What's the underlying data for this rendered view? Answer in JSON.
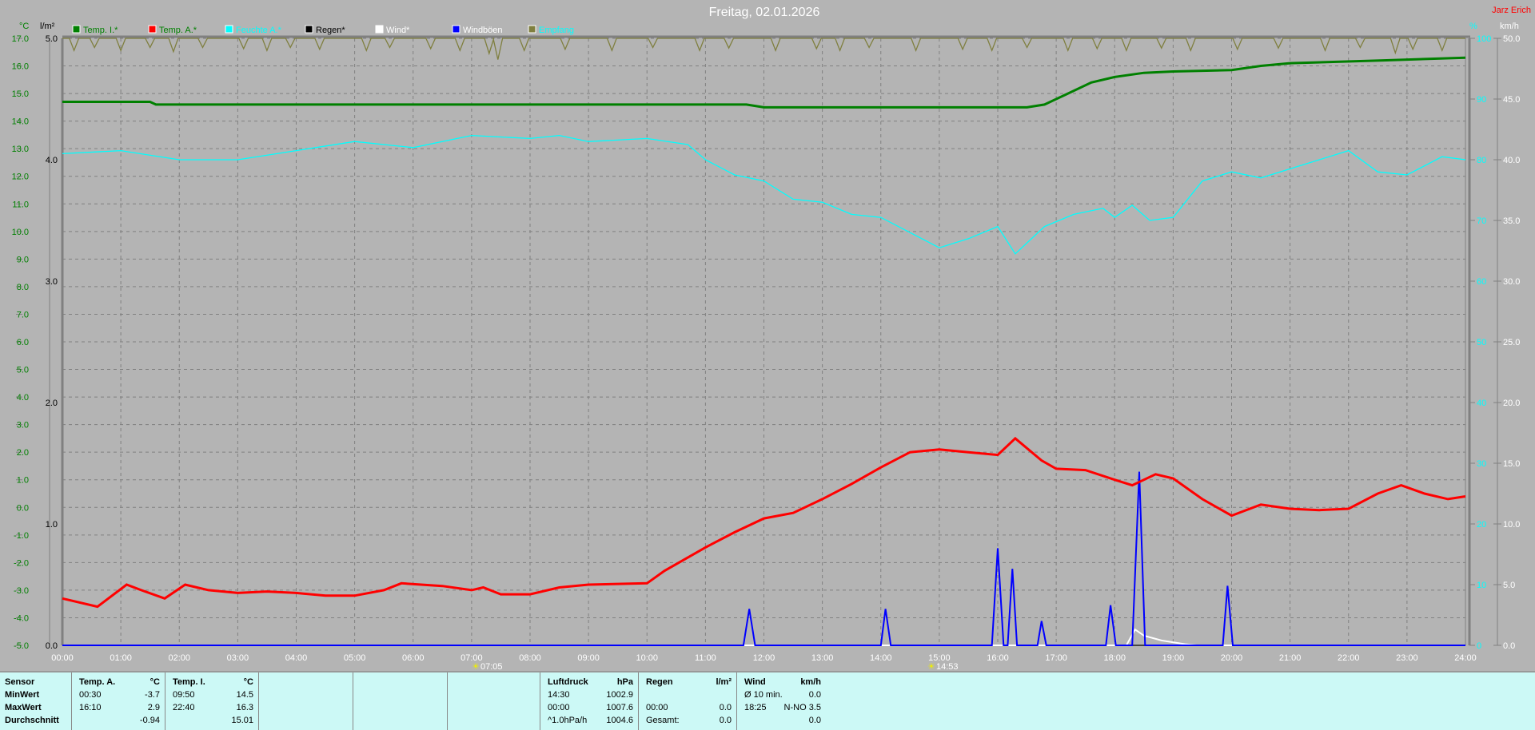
{
  "title": "Freitag, 02.01.2026",
  "author": "Jarz Erich",
  "legend": [
    {
      "label": "Temp. I.*",
      "color": "#008000"
    },
    {
      "label": "Temp. A.*",
      "color": "#ff0000",
      "text_color": "#008000"
    },
    {
      "label": "Feuchte A.*",
      "color": "#00ffff"
    },
    {
      "label": "Regen*",
      "color": "#000000"
    },
    {
      "label": "Wind*",
      "color": "#ffffff"
    },
    {
      "label": "Windböen",
      "color": "#0000ff",
      "text_color": "#ffffff"
    },
    {
      "label": "Empfang",
      "color": "#7f7f3f",
      "text_color": "#00ffff"
    }
  ],
  "axes": {
    "temp_unit": "°C",
    "rain_unit": "l/m²",
    "hum_unit": "%",
    "wind_unit": "km/h"
  },
  "sun": {
    "sunrise": "07:05",
    "sunset": "14:53"
  },
  "chart_data": {
    "type": "line",
    "title": "Freitag, 02.01.2026",
    "x_range": [
      0,
      24
    ],
    "x_ticks": [
      "00:00",
      "01:00",
      "02:00",
      "03:00",
      "04:00",
      "05:00",
      "06:00",
      "07:00",
      "08:00",
      "09:00",
      "10:00",
      "11:00",
      "12:00",
      "13:00",
      "14:00",
      "15:00",
      "16:00",
      "17:00",
      "18:00",
      "19:00",
      "20:00",
      "21:00",
      "22:00",
      "23:00",
      "24:00"
    ],
    "y_temp": {
      "range": [
        -5,
        17
      ],
      "ticks": [
        "17.0",
        "16.0",
        "15.0",
        "14.0",
        "13.0",
        "12.0",
        "11.0",
        "10.0",
        "9.0",
        "8.0",
        "7.0",
        "6.0",
        "5.0",
        "4.0",
        "3.0",
        "2.0",
        "1.0",
        "0.0",
        "-1.0",
        "-2.0",
        "-3.0",
        "-4.0",
        "-5.0"
      ]
    },
    "y_rain": {
      "range": [
        0,
        5
      ],
      "ticks": [
        "5.0",
        "4.0",
        "3.0",
        "2.0",
        "1.0",
        "0.0"
      ]
    },
    "y_hum": {
      "range": [
        0,
        100
      ],
      "ticks": [
        "100",
        "90",
        "80",
        "70",
        "60",
        "50",
        "40",
        "30",
        "20",
        "10",
        "0"
      ]
    },
    "y_wind": {
      "range": [
        0,
        50
      ],
      "ticks": [
        "50.0",
        "45.0",
        "40.0",
        "35.0",
        "30.0",
        "25.0",
        "20.0",
        "15.0",
        "10.0",
        "5.0",
        "0.0"
      ]
    },
    "grid": true,
    "series": [
      {
        "name": "Temp. I.",
        "axis": "temp",
        "color": "#008000",
        "points": [
          [
            0,
            14.7
          ],
          [
            1.5,
            14.7
          ],
          [
            1.6,
            14.6
          ],
          [
            11.7,
            14.6
          ],
          [
            12,
            14.5
          ],
          [
            16.5,
            14.5
          ],
          [
            16.8,
            14.6
          ],
          [
            17.2,
            15.0
          ],
          [
            17.6,
            15.4
          ],
          [
            18,
            15.6
          ],
          [
            18.5,
            15.75
          ],
          [
            19,
            15.8
          ],
          [
            20,
            15.85
          ],
          [
            20.5,
            16.0
          ],
          [
            21,
            16.1
          ],
          [
            22.6,
            16.2
          ],
          [
            24,
            16.3
          ]
        ]
      },
      {
        "name": "Temp. A.",
        "axis": "temp",
        "color": "#ff0000",
        "points": [
          [
            0,
            -3.3
          ],
          [
            0.6,
            -3.6
          ],
          [
            1.1,
            -2.8
          ],
          [
            1.35,
            -3.0
          ],
          [
            1.75,
            -3.3
          ],
          [
            2.1,
            -2.8
          ],
          [
            2.5,
            -3.0
          ],
          [
            3,
            -3.1
          ],
          [
            3.5,
            -3.05
          ],
          [
            4,
            -3.1
          ],
          [
            4.5,
            -3.2
          ],
          [
            5,
            -3.2
          ],
          [
            5.5,
            -3.0
          ],
          [
            5.8,
            -2.75
          ],
          [
            6.5,
            -2.85
          ],
          [
            7,
            -3.0
          ],
          [
            7.2,
            -2.9
          ],
          [
            7.5,
            -3.15
          ],
          [
            8,
            -3.15
          ],
          [
            8.5,
            -2.9
          ],
          [
            9,
            -2.8
          ],
          [
            10,
            -2.75
          ],
          [
            10.3,
            -2.3
          ],
          [
            11,
            -1.45
          ],
          [
            11.5,
            -0.9
          ],
          [
            12,
            -0.4
          ],
          [
            12.5,
            -0.2
          ],
          [
            13,
            0.3
          ],
          [
            13.5,
            0.85
          ],
          [
            14,
            1.45
          ],
          [
            14.5,
            2.0
          ],
          [
            15,
            2.1
          ],
          [
            15.5,
            2.0
          ],
          [
            16,
            1.9
          ],
          [
            16.3,
            2.5
          ],
          [
            16.75,
            1.7
          ],
          [
            17,
            1.4
          ],
          [
            17.5,
            1.35
          ],
          [
            18,
            1.0
          ],
          [
            18.3,
            0.8
          ],
          [
            18.7,
            1.2
          ],
          [
            19,
            1.05
          ],
          [
            19.5,
            0.3
          ],
          [
            20,
            -0.3
          ],
          [
            20.5,
            0.1
          ],
          [
            21,
            -0.05
          ],
          [
            21.5,
            -0.1
          ],
          [
            22,
            -0.05
          ],
          [
            22.5,
            0.5
          ],
          [
            22.9,
            0.8
          ],
          [
            23.3,
            0.5
          ],
          [
            23.7,
            0.3
          ],
          [
            24,
            0.4
          ]
        ]
      },
      {
        "name": "Feuchte A.",
        "axis": "hum",
        "color": "#00ffff",
        "points": [
          [
            0,
            81
          ],
          [
            1,
            81.5
          ],
          [
            2,
            80
          ],
          [
            3,
            80
          ],
          [
            4,
            81.5
          ],
          [
            5,
            83
          ],
          [
            6,
            82
          ],
          [
            7,
            84
          ],
          [
            8,
            83.5
          ],
          [
            8.5,
            84
          ],
          [
            9,
            83
          ],
          [
            10,
            83.5
          ],
          [
            10.7,
            82.5
          ],
          [
            11,
            80
          ],
          [
            11.5,
            77.5
          ],
          [
            12,
            76.5
          ],
          [
            12.5,
            73.5
          ],
          [
            13,
            73
          ],
          [
            13.5,
            71
          ],
          [
            14,
            70.5
          ],
          [
            14.5,
            68
          ],
          [
            15,
            65.5
          ],
          [
            15.5,
            67
          ],
          [
            16,
            69
          ],
          [
            16.3,
            64.5
          ],
          [
            16.8,
            69
          ],
          [
            17.3,
            71
          ],
          [
            17.8,
            72
          ],
          [
            18,
            70.5
          ],
          [
            18.3,
            72.5
          ],
          [
            18.6,
            70
          ],
          [
            19,
            70.5
          ],
          [
            19.5,
            76.5
          ],
          [
            20,
            78
          ],
          [
            20.5,
            77
          ],
          [
            21,
            78.5
          ],
          [
            21.5,
            80
          ],
          [
            22,
            81.5
          ],
          [
            22.5,
            78
          ],
          [
            23,
            77.5
          ],
          [
            23.6,
            80.5
          ],
          [
            24,
            80
          ]
        ]
      },
      {
        "name": "Regen",
        "axis": "rain",
        "color": "#000000",
        "points": [
          [
            0,
            0
          ],
          [
            24,
            0
          ]
        ]
      },
      {
        "name": "Wind",
        "axis": "wind",
        "color": "#ffffff",
        "points": [
          [
            0,
            0
          ],
          [
            18.2,
            0
          ],
          [
            18.35,
            1.3
          ],
          [
            18.5,
            0.8
          ],
          [
            18.8,
            0.4
          ],
          [
            19.2,
            0.1
          ],
          [
            19.4,
            0
          ],
          [
            24,
            0
          ]
        ]
      },
      {
        "name": "Windböen",
        "axis": "wind",
        "color": "#0000ff",
        "points": [
          [
            0,
            0
          ],
          [
            11.65,
            0
          ],
          [
            11.75,
            3
          ],
          [
            11.85,
            0
          ],
          [
            14,
            0
          ],
          [
            14.08,
            3
          ],
          [
            14.17,
            0
          ],
          [
            15.9,
            0
          ],
          [
            16,
            8
          ],
          [
            16.1,
            0
          ],
          [
            16.17,
            0
          ],
          [
            16.25,
            6.3
          ],
          [
            16.33,
            0
          ],
          [
            16.68,
            0
          ],
          [
            16.75,
            2
          ],
          [
            16.83,
            0
          ],
          [
            17.85,
            0
          ],
          [
            17.93,
            3.3
          ],
          [
            18.02,
            0
          ],
          [
            18.3,
            0
          ],
          [
            18.42,
            14.3
          ],
          [
            18.52,
            0
          ],
          [
            19.85,
            0
          ],
          [
            19.93,
            4.9
          ],
          [
            20.02,
            0
          ],
          [
            24,
            0
          ]
        ]
      },
      {
        "name": "Empfang",
        "axis": "hum",
        "color": "#7f7f3f",
        "baseline": 100,
        "dips": [
          [
            0.2,
            98
          ],
          [
            0.55,
            98.5
          ],
          [
            1.0,
            98
          ],
          [
            1.5,
            98.5
          ],
          [
            1.9,
            97.8
          ],
          [
            2.4,
            98.5
          ],
          [
            3.1,
            98.3
          ],
          [
            3.5,
            98
          ],
          [
            3.9,
            98.5
          ],
          [
            4.4,
            98.2
          ],
          [
            5.2,
            98
          ],
          [
            5.6,
            98.5
          ],
          [
            6.3,
            98.3
          ],
          [
            6.8,
            98
          ],
          [
            7.3,
            97.5
          ],
          [
            7.45,
            96.5
          ],
          [
            7.9,
            98
          ],
          [
            8.6,
            98.2
          ],
          [
            9.4,
            98
          ],
          [
            10.1,
            98.5
          ],
          [
            10.9,
            98
          ],
          [
            11.4,
            98.4
          ],
          [
            12.2,
            98
          ],
          [
            12.9,
            98.3
          ],
          [
            13.3,
            98
          ],
          [
            13.8,
            98.5
          ],
          [
            14.6,
            98
          ],
          [
            15.4,
            98.2
          ],
          [
            15.9,
            98
          ],
          [
            16.5,
            98.5
          ],
          [
            17.2,
            98
          ],
          [
            17.7,
            98.3
          ],
          [
            18.2,
            98
          ],
          [
            18.8,
            98.4
          ],
          [
            19.3,
            98
          ],
          [
            20.1,
            98.2
          ],
          [
            20.8,
            98.4
          ],
          [
            21.6,
            98
          ],
          [
            22.2,
            98.5
          ],
          [
            22.8,
            97.6
          ],
          [
            23.1,
            98.2
          ],
          [
            23.6,
            98
          ]
        ]
      }
    ]
  },
  "table": {
    "sensor_col": [
      "Sensor",
      "MinWert",
      "MaxWert",
      "Durchschnitt"
    ],
    "temp_a": {
      "header": "Temp. A.",
      "unit": "°C",
      "rows": [
        [
          "00:30",
          "-3.7"
        ],
        [
          "16:10",
          "2.9"
        ],
        [
          "",
          "-0.94"
        ]
      ]
    },
    "temp_i": {
      "header": "Temp. I.",
      "unit": "°C",
      "rows": [
        [
          "09:50",
          "14.5"
        ],
        [
          "22:40",
          "16.3"
        ],
        [
          "",
          "15.01"
        ]
      ]
    },
    "pressure": {
      "header": "Luftdruck",
      "unit": "hPa",
      "rows": [
        [
          "14:30",
          "1002.9"
        ],
        [
          "00:00",
          "1007.6"
        ],
        [
          "^1.0hPa/h",
          "1004.6"
        ]
      ]
    },
    "rain": {
      "header": "Regen",
      "unit": "l/m²",
      "rows": [
        [
          "",
          ""
        ],
        [
          "00:00",
          "0.0"
        ],
        [
          "Gesamt:",
          "0.0"
        ]
      ]
    },
    "wind": {
      "header": "Wind",
      "unit": "km/h",
      "rows": [
        [
          "Ø 10 min.",
          "0.0"
        ],
        [
          "18:25",
          "N-NO 3.5"
        ],
        [
          "",
          "0.0"
        ]
      ]
    }
  }
}
